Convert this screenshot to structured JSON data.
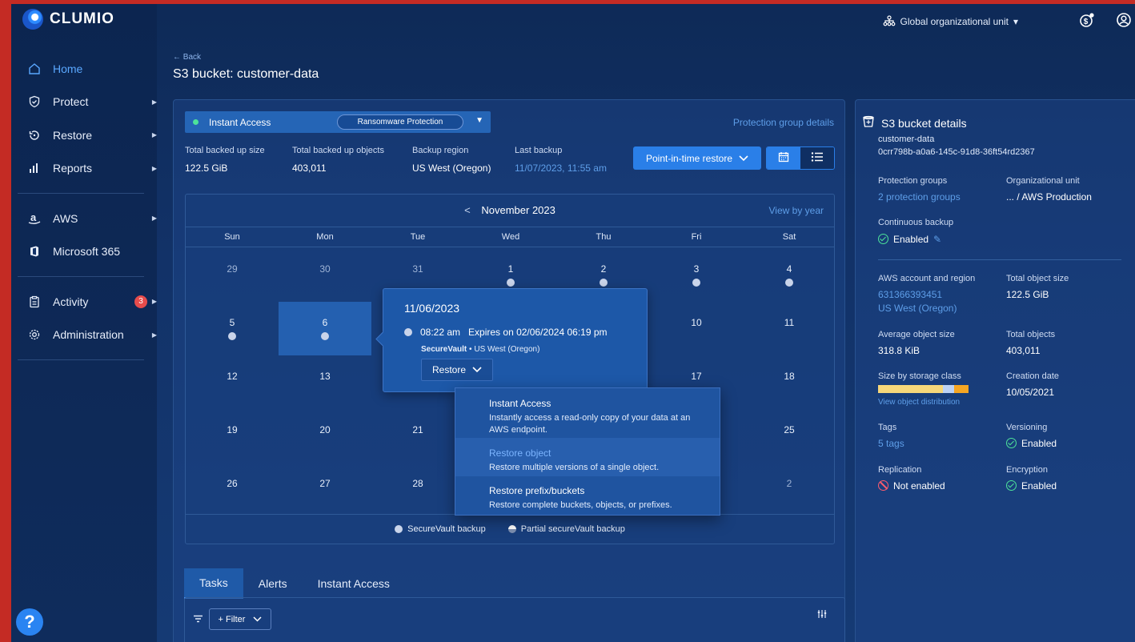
{
  "brand": {
    "name": "CLUMIO"
  },
  "topbar": {
    "org_label": "Global organizational unit",
    "org_caret": "▾"
  },
  "sidebar": {
    "items": [
      {
        "label": "Home"
      },
      {
        "label": "Protect"
      },
      {
        "label": "Restore"
      },
      {
        "label": "Reports"
      },
      {
        "label": "AWS"
      },
      {
        "label": "Microsoft 365"
      },
      {
        "label": "Activity",
        "badge": "3"
      },
      {
        "label": "Administration"
      }
    ],
    "help": "?"
  },
  "page": {
    "back": "← Back",
    "title": "S3 bucket: customer-data"
  },
  "protection": {
    "instant_access": "Instant Access",
    "ransomware_chip": "Ransomware Protection",
    "pg_link": "Protection group details"
  },
  "stats": [
    {
      "label": "Total backed up size",
      "value": "122.5 GiB"
    },
    {
      "label": "Total backed up objects",
      "value": "403,011"
    },
    {
      "label": "Backup region",
      "value": "US West (Oregon)"
    },
    {
      "label": "Last backup",
      "value": "11/07/2023, 11:55 am"
    }
  ],
  "actions": {
    "pit_restore": "Point-in-time restore"
  },
  "calendar": {
    "month": "November 2023",
    "view_by_year": "View by year",
    "days_of_week": [
      "Sun",
      "Mon",
      "Tue",
      "Wed",
      "Thu",
      "Fri",
      "Sat"
    ],
    "weeks": [
      [
        "29",
        "30",
        "31",
        "1",
        "2",
        "3",
        "4"
      ],
      [
        "5",
        "6",
        "",
        "",
        "",
        "10",
        "11"
      ],
      [
        "12",
        "13",
        "",
        "",
        "",
        "17",
        "18"
      ],
      [
        "19",
        "20",
        "21",
        "",
        "",
        "",
        "25"
      ],
      [
        "26",
        "27",
        "28",
        "",
        "",
        "",
        "2"
      ]
    ],
    "legend": {
      "full": "SecureVault backup",
      "partial": "Partial secureVault backup"
    }
  },
  "popover": {
    "date": "11/06/2023",
    "time": "08:22 am",
    "expires": "Expires on 02/06/2024 06:19 pm",
    "vault": "SecureVault",
    "sep": "•",
    "region": "US West (Oregon)",
    "restore_btn": "Restore"
  },
  "restore_menu": [
    {
      "title": "Instant Access",
      "desc": "Instantly access a read-only copy of your data at an AWS endpoint."
    },
    {
      "title": "Restore object",
      "desc": "Restore multiple versions of a single object."
    },
    {
      "title": "Restore prefix/buckets",
      "desc": "Restore complete buckets, objects, or prefixes."
    }
  ],
  "tabs": [
    "Tasks",
    "Alerts",
    "Instant Access"
  ],
  "table": {
    "filter": "+ Filter"
  },
  "details": {
    "title": "S3 bucket details",
    "name": "customer-data",
    "id": "0crr798b-a0a6-145c-91d8-36ft54rd2367",
    "protection_groups_label": "Protection groups",
    "protection_groups_value": "2 protection groups",
    "org_unit_label": "Organizational unit",
    "org_unit_value": "... / AWS Production",
    "continuous_label": "Continuous backup",
    "continuous_value": "Enabled",
    "aws_label": "AWS account and region",
    "aws_account": "631366393451",
    "aws_region": "US West (Oregon)",
    "total_size_label": "Total object size",
    "total_size_value": "122.5 GiB",
    "avg_size_label": "Average object size",
    "avg_size_value": "318.8 KiB",
    "total_objects_label": "Total objects",
    "total_objects_value": "403,011",
    "storage_label": "Size by storage class",
    "storage_link": "View object distribution",
    "creation_label": "Creation date",
    "creation_value": "10/05/2021",
    "tags_label": "Tags",
    "tags_value": "5 tags",
    "versioning_label": "Versioning",
    "versioning_value": "Enabled",
    "replication_label": "Replication",
    "replication_value": "Not enabled",
    "encryption_label": "Encryption",
    "encryption_value": "Enabled"
  },
  "colors": {
    "accent": "#2a7fe8",
    "link": "#5e9ee8",
    "enabled": "#4de39a",
    "disabled": "#ff5c6e"
  }
}
